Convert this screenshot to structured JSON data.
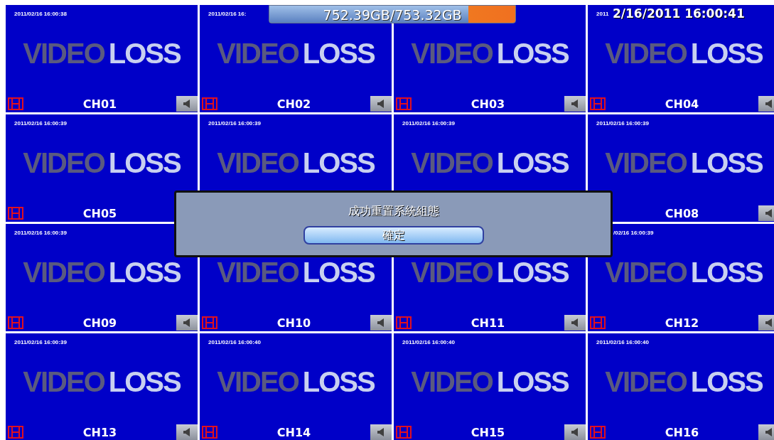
{
  "storage": {
    "text": "752.39GB/753.32GB",
    "level": 0.81
  },
  "clock": "2/16/2011 16:00:41",
  "channels": [
    {
      "name": "CH01",
      "timestamp": "2011/02/16 16:00:38",
      "overlay": [
        "VIDEO",
        "LOSS"
      ],
      "film_visible": true,
      "speaker_visible": true
    },
    {
      "name": "CH02",
      "timestamp": "2011/02/16 16:",
      "overlay": [
        "VIDEO",
        "LOSS"
      ],
      "film_visible": true,
      "speaker_visible": true
    },
    {
      "name": "CH03",
      "overlay": [
        "VIDEO",
        "LOSS"
      ],
      "film_visible": true,
      "speaker_visible": true
    },
    {
      "name": "CH04",
      "timestamp": "2011",
      "overlay": [
        "VIDEO",
        "LOSS"
      ],
      "film_visible": true,
      "speaker_visible": true
    },
    {
      "name": "CH05",
      "timestamp": "2011/02/16 16:00:39",
      "overlay": [
        "VIDEO",
        "LOSS"
      ],
      "film_visible": true,
      "speaker_visible": false
    },
    {
      "timestamp": "2011/02/16 16:00:39",
      "overlay": [
        "VIDEO",
        "LOSS"
      ],
      "film_visible": false,
      "speaker_visible": false
    },
    {
      "timestamp": "2011/02/16 16:00:39",
      "overlay": [
        "VIDEO",
        "LOSS"
      ],
      "film_visible": false,
      "speaker_visible": false
    },
    {
      "name": "CH08",
      "timestamp": "2011/02/16 16:00:39",
      "overlay": [
        "VIDEO",
        "LOSS"
      ],
      "film_visible": false,
      "speaker_visible": true
    },
    {
      "name": "CH09",
      "timestamp": "2011/02/16 16:00:39",
      "overlay": [
        "VIDEO",
        "LOSS"
      ],
      "film_visible": true,
      "speaker_visible": true
    },
    {
      "name": "CH10",
      "overlay": [
        "VIDEO",
        "LOSS"
      ],
      "film_visible": true,
      "speaker_visible": true
    },
    {
      "name": "CH11",
      "overlay": [
        "VIDEO",
        "LOSS"
      ],
      "film_visible": true,
      "speaker_visible": true
    },
    {
      "name": "CH12",
      "timestamp": "/02/16 16:00:39",
      "overlay": [
        "VIDEO",
        "LOSS"
      ],
      "film_visible": true,
      "speaker_visible": true
    },
    {
      "name": "CH13",
      "timestamp": "2011/02/16 16:00:39",
      "overlay": [
        "VIDEO",
        "LOSS"
      ],
      "film_visible": true,
      "speaker_visible": true
    },
    {
      "name": "CH14",
      "timestamp": "2011/02/16 16:00:40",
      "overlay": [
        "VIDEO",
        "LOSS"
      ],
      "film_visible": true,
      "speaker_visible": true
    },
    {
      "name": "CH15",
      "timestamp": "2011/02/16 16:00:40",
      "overlay": [
        "VIDEO",
        "LOSS"
      ],
      "film_visible": true,
      "speaker_visible": true
    },
    {
      "name": "CH16",
      "timestamp": "2011/02/16 16:00:40",
      "overlay": [
        "VIDEO",
        "LOSS"
      ],
      "film_visible": true,
      "speaker_visible": true
    }
  ],
  "dialog": {
    "message": "成功重置系統組態",
    "button": "確定"
  }
}
